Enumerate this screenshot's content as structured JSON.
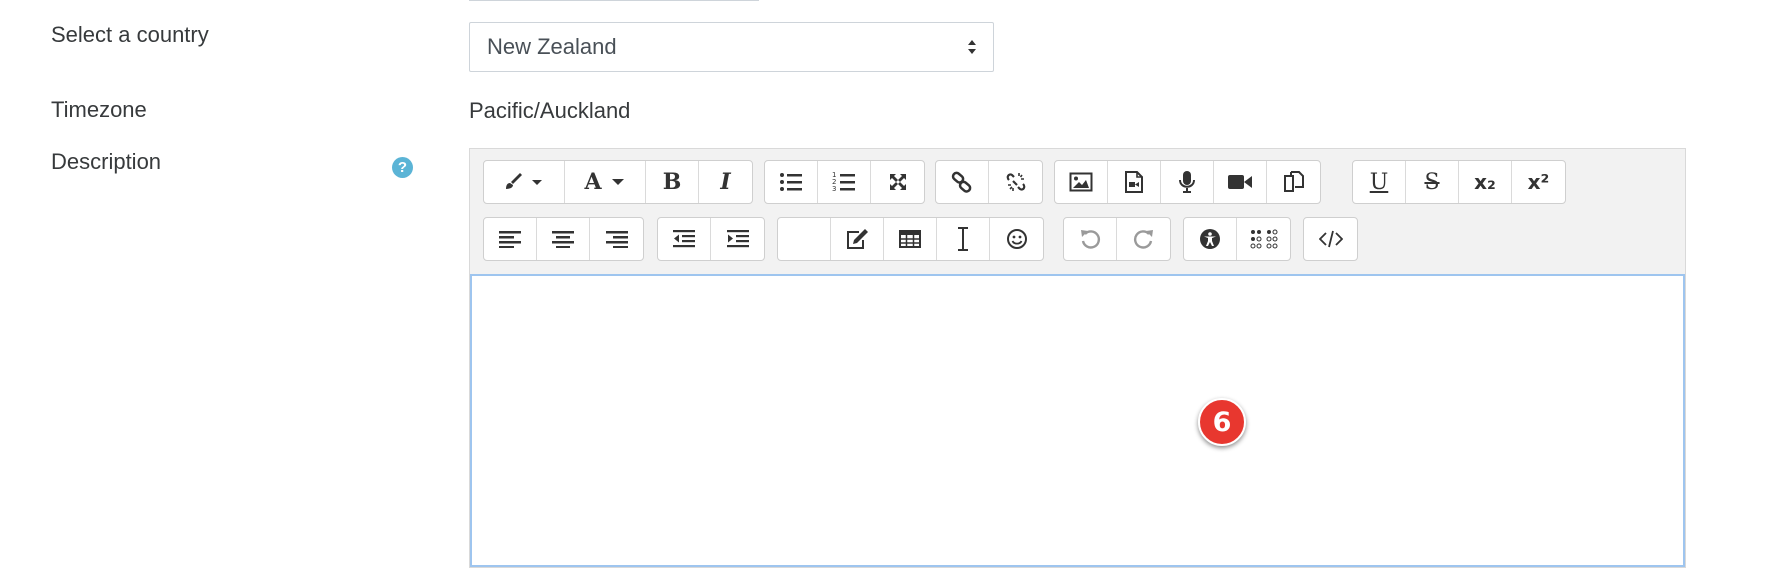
{
  "form": {
    "country_label": "Select a country",
    "country_value": "New Zealand",
    "timezone_label": "Timezone",
    "timezone_value": "Pacific/Auckland",
    "description_label": "Description",
    "help_glyph": "?"
  },
  "editor": {
    "row1_groups": [
      [
        "brush-icon",
        "font-color-icon",
        "bold-icon",
        "italic-icon"
      ],
      [
        "unordered-list-icon",
        "ordered-list-icon",
        "fullscreen-icon"
      ],
      [
        "link-icon",
        "unlink-icon"
      ],
      [
        "image-icon",
        "media-icon",
        "record-audio-icon",
        "record-video-icon",
        "manage-files-icon"
      ],
      [
        "underline-icon",
        "strikethrough-icon",
        "subscript-icon",
        "superscript-icon"
      ]
    ],
    "row2_groups": [
      [
        "align-left-icon",
        "align-center-icon",
        "align-right-icon"
      ],
      [
        "outdent-icon",
        "indent-icon"
      ],
      [
        "blank",
        "equation-icon",
        "table-icon",
        "special-character-icon",
        "emoji-icon"
      ],
      [
        "undo-icon",
        "redo-icon"
      ],
      [
        "accessibility-checker-icon",
        "screenreader-helper-icon"
      ],
      [
        "html-icon"
      ]
    ],
    "bold_glyph": "B",
    "italic_glyph": "I",
    "font_glyph": "A",
    "underline_glyph": "U",
    "strike_glyph": "S",
    "subscript_glyph": "x₂",
    "superscript_glyph": "x²",
    "content": ""
  },
  "annotation": {
    "step_number": "6",
    "color": "#e8372f"
  }
}
